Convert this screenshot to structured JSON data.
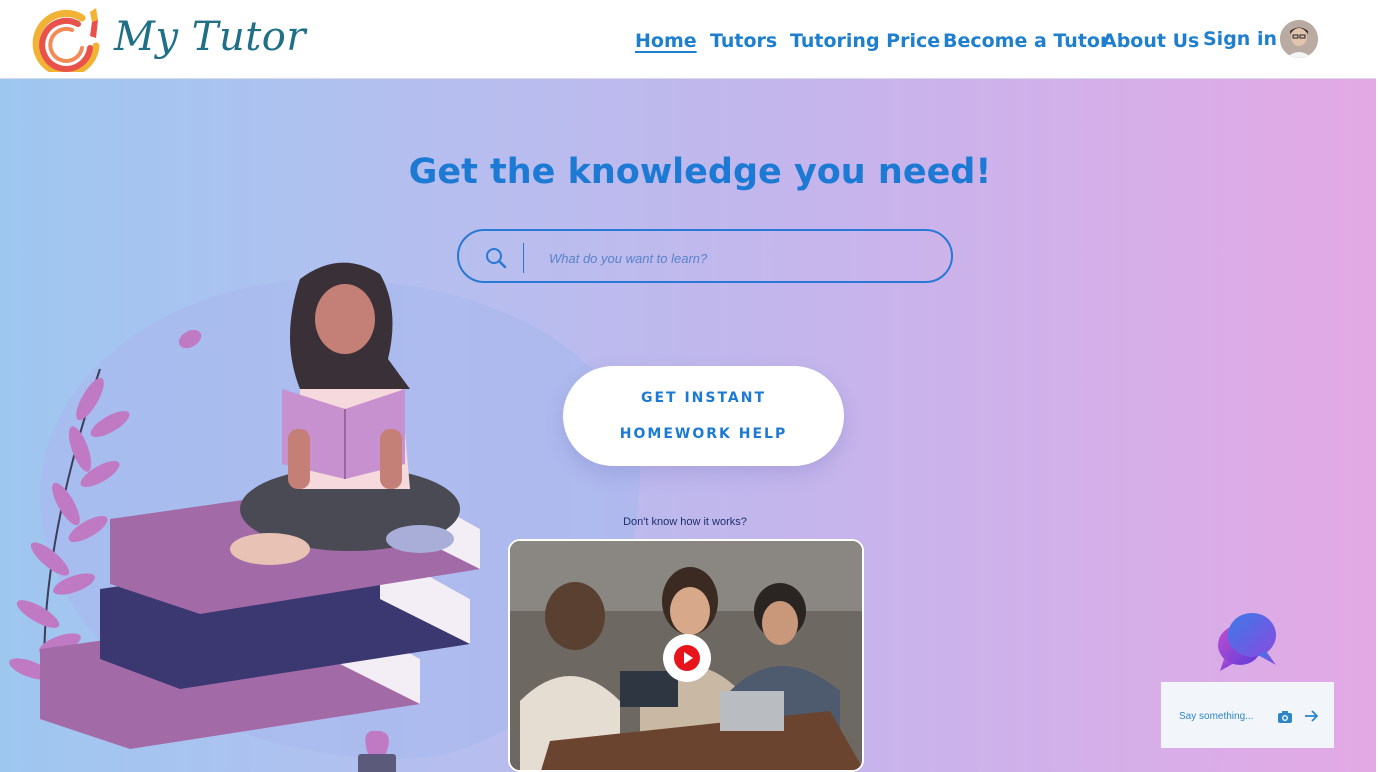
{
  "brand": {
    "name": "My Tutor"
  },
  "nav": {
    "items": [
      {
        "label": "Home",
        "active": true
      },
      {
        "label": "Tutors"
      },
      {
        "label": "Tutoring Price"
      },
      {
        "label": "Become a Tutor"
      },
      {
        "label": "About Us"
      },
      {
        "label": "Sign in"
      }
    ]
  },
  "hero": {
    "headline": "Get the knowledge you need!",
    "search_placeholder": "What do you want to learn?",
    "cta_line1": "GET INSTANT",
    "cta_line2": "HOMEWORK HELP",
    "video_caption": "Don't know how it works?"
  },
  "chat": {
    "placeholder": "Say something..."
  },
  "colors": {
    "accent": "#1d7ad4",
    "logo_text": "#1f6f87",
    "gradient_start": "#9ec7f0",
    "gradient_end": "#e3a9e5",
    "play_red": "#e8141c"
  },
  "icons": [
    "search-icon",
    "play-icon",
    "chat-bubble-icon",
    "camera-icon",
    "send-arrow-icon",
    "avatar"
  ]
}
